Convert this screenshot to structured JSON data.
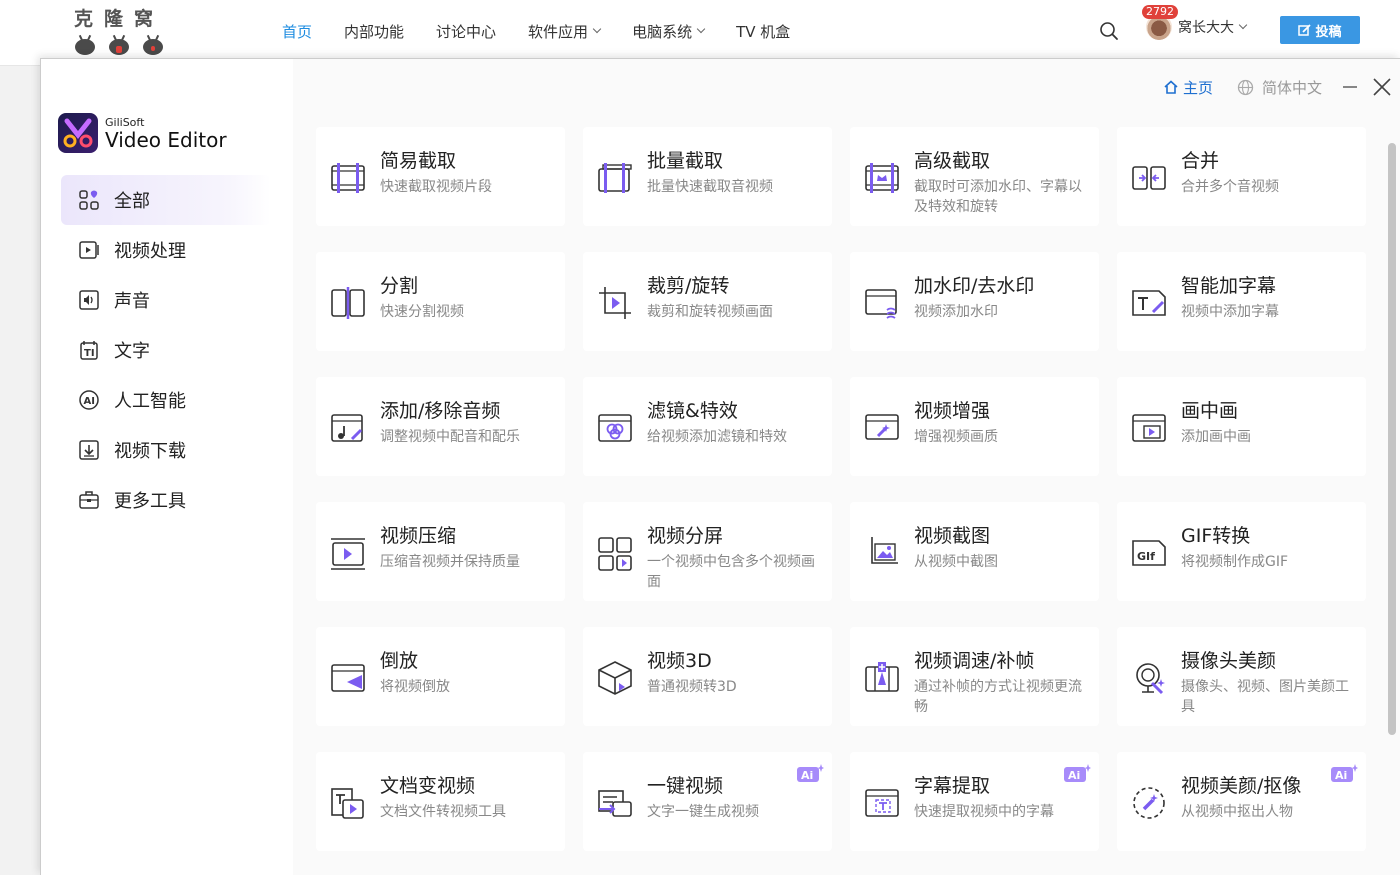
{
  "site": {
    "logo_text": "克隆窝",
    "nav": [
      {
        "label": "首页",
        "active": true,
        "has_caret": false
      },
      {
        "label": "内部功能",
        "active": false,
        "has_caret": false
      },
      {
        "label": "讨论中心",
        "active": false,
        "has_caret": false
      },
      {
        "label": "软件应用",
        "active": false,
        "has_caret": true
      },
      {
        "label": "电脑系统",
        "active": false,
        "has_caret": true
      },
      {
        "label": "TV 机盒",
        "active": false,
        "has_caret": false
      }
    ],
    "notification_count": "2792",
    "user_name": "窝长大大",
    "post_button": "投稿"
  },
  "app": {
    "brand_small": "GiliSoft",
    "brand_big": "Video Editor",
    "home_label": "主页",
    "language": "简体中文",
    "accent_color": "#7b5cf0",
    "categories": [
      {
        "label": "全部",
        "icon": "grid-icon",
        "active": true
      },
      {
        "label": "视频处理",
        "icon": "video-play-icon",
        "active": false
      },
      {
        "label": "声音",
        "icon": "speaker-icon",
        "active": false
      },
      {
        "label": "文字",
        "icon": "text-icon",
        "active": false
      },
      {
        "label": "人工智能",
        "icon": "ai-icon",
        "active": false
      },
      {
        "label": "视频下载",
        "icon": "download-icon",
        "active": false
      },
      {
        "label": "更多工具",
        "icon": "toolbox-icon",
        "active": false
      }
    ],
    "tools": [
      {
        "title": "简易截取",
        "desc": "快速截取视频片段",
        "icon": "simple-trim-icon",
        "ai": false
      },
      {
        "title": "批量截取",
        "desc": "批量快速截取音视频",
        "icon": "batch-trim-icon",
        "ai": false
      },
      {
        "title": "高级截取",
        "desc": "截取时可添加水印、字幕以及特效和旋转",
        "icon": "advanced-trim-icon",
        "ai": false
      },
      {
        "title": "合并",
        "desc": "合并多个音视频",
        "icon": "merge-icon",
        "ai": false
      },
      {
        "title": "分割",
        "desc": "快速分割视频",
        "icon": "split-icon",
        "ai": false
      },
      {
        "title": "裁剪/旋转",
        "desc": "裁剪和旋转视频画面",
        "icon": "crop-rotate-icon",
        "ai": false
      },
      {
        "title": "加水印/去水印",
        "desc": "视频添加水印",
        "icon": "watermark-icon",
        "ai": false
      },
      {
        "title": "智能加字幕",
        "desc": "视频中添加字幕",
        "icon": "subtitle-icon",
        "ai": false
      },
      {
        "title": "添加/移除音频",
        "desc": "调整视频中配音和配乐",
        "icon": "audio-icon",
        "ai": false
      },
      {
        "title": "滤镜&特效",
        "desc": "给视频添加滤镜和特效",
        "icon": "filter-icon",
        "ai": false
      },
      {
        "title": "视频增强",
        "desc": "增强视频画质",
        "icon": "enhance-icon",
        "ai": false
      },
      {
        "title": "画中画",
        "desc": "添加画中画",
        "icon": "pip-icon",
        "ai": false
      },
      {
        "title": "视频压缩",
        "desc": "压缩音视频并保持质量",
        "icon": "compress-icon",
        "ai": false
      },
      {
        "title": "视频分屏",
        "desc": "一个视频中包含多个视频画面",
        "icon": "split-screen-icon",
        "ai": false
      },
      {
        "title": "视频截图",
        "desc": "从视频中截图",
        "icon": "screenshot-icon",
        "ai": false
      },
      {
        "title": "GIF转换",
        "desc": "将视频制作成GIF",
        "icon": "gif-icon",
        "ai": false
      },
      {
        "title": "倒放",
        "desc": "将视频倒放",
        "icon": "reverse-icon",
        "ai": false
      },
      {
        "title": "视频3D",
        "desc": "普通视频转3D",
        "icon": "cube-3d-icon",
        "ai": false
      },
      {
        "title": "视频调速/补帧",
        "desc": "通过补帧的方式让视频更流畅",
        "icon": "speed-icon",
        "ai": false
      },
      {
        "title": "摄像头美颜",
        "desc": "摄像头、视频、图片美颜工具",
        "icon": "webcam-beauty-icon",
        "ai": false
      },
      {
        "title": "文档变视频",
        "desc": "文档文件转视频工具",
        "icon": "doc-to-video-icon",
        "ai": false
      },
      {
        "title": "一键视频",
        "desc": "文字一键生成视频",
        "icon": "one-click-video-icon",
        "ai": true
      },
      {
        "title": "字幕提取",
        "desc": "快速提取视频中的字幕",
        "icon": "subtitle-extract-icon",
        "ai": true
      },
      {
        "title": "视频美颜/抠像",
        "desc": "从视频中抠出人物",
        "icon": "cutout-icon",
        "ai": true
      }
    ],
    "ai_badge_text": "Ai"
  }
}
